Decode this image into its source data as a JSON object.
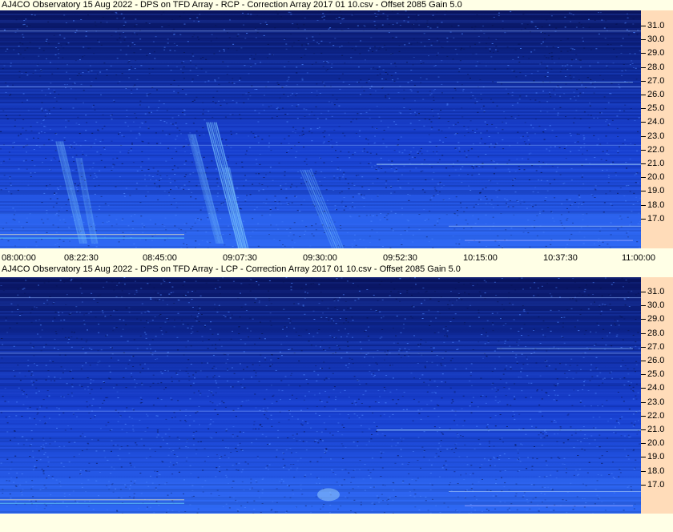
{
  "panels": [
    {
      "title": "AJ4CO Observatory 15 Aug 2022  -  DPS on TFD Array  -  RCP  -  Correction Array 2017 01 10.csv  -  Offset 2085  Gain 5.0",
      "freq_labels": [
        "31.0",
        "30.0",
        "29.0",
        "28.0",
        "27.0",
        "26.0",
        "25.0",
        "24.0",
        "23.0",
        "22.0",
        "21.0",
        "20.0",
        "19.0",
        "18.0",
        "17.0"
      ],
      "time_labels": [
        "08:00:00",
        "08:22:30",
        "08:45:00",
        "09:07:30",
        "09:30:00",
        "09:52:30",
        "10:15:00",
        "10:37:30",
        "11:00:00"
      ],
      "polarization": "RCP"
    },
    {
      "title": "AJ4CO Observatory 15 Aug 2022  -  DPS on TFD Array  -  LCP  -  Correction Array 2017 01 10.csv  -  Offset 2085  Gain 5.0",
      "freq_labels": [
        "31.0",
        "30.0",
        "29.0",
        "28.0",
        "27.0",
        "26.0",
        "25.0",
        "24.0",
        "23.0",
        "22.0",
        "21.0",
        "20.0",
        "19.0",
        "18.0",
        "17.0"
      ],
      "time_labels": [],
      "polarization": "LCP"
    }
  ],
  "colors": {
    "background": "#ffffe6",
    "freq_axis_bg": "#ffdcb9",
    "spectrogram_dark": "#0b1a6e",
    "spectrogram_mid": "#1f4fe0",
    "spectrogram_bright": "#6fb8ff"
  }
}
